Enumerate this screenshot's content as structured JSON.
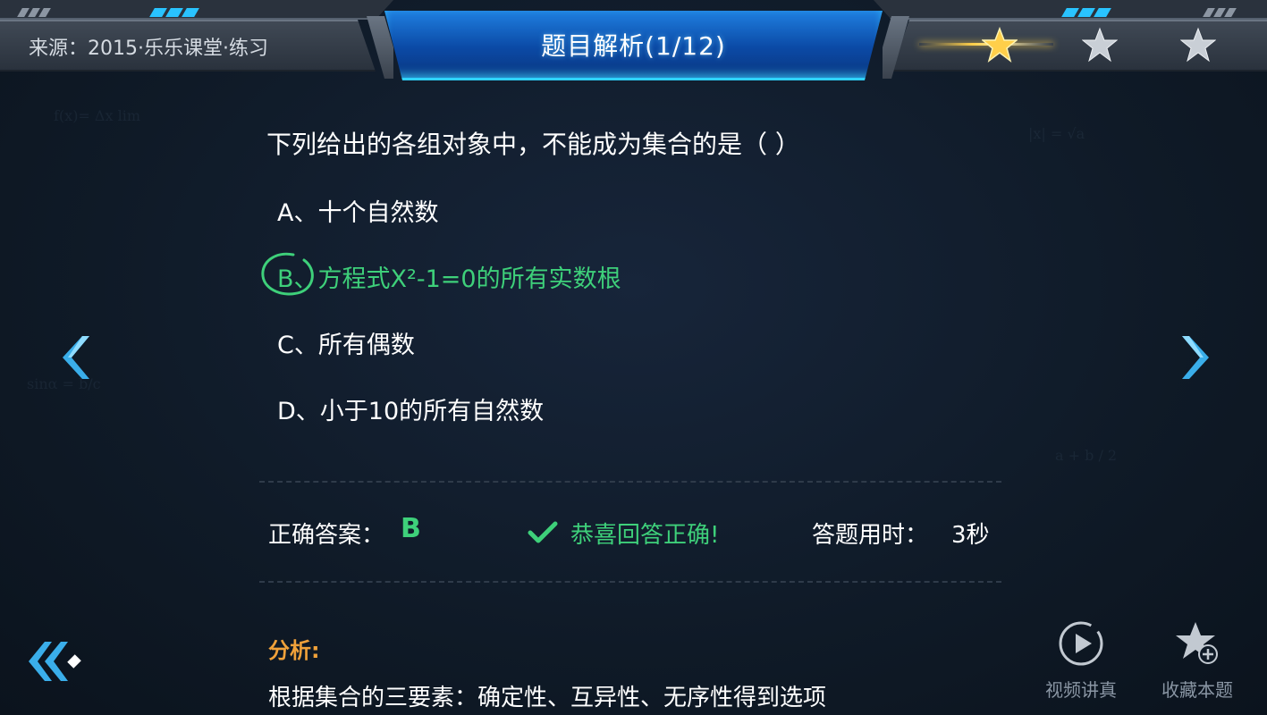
{
  "header": {
    "source": "来源：2015·乐乐课堂·练习",
    "title": "题目解析(1/12)",
    "stars": {
      "filled": 1,
      "total": 3
    }
  },
  "question": {
    "stem": "下列给出的各组对象中，不能成为集合的是（      ）",
    "options": [
      {
        "letter": "A、",
        "text": "十个自然数"
      },
      {
        "letter": "B、",
        "text": "方程式X²-1=0的所有实数根"
      },
      {
        "letter": "C、",
        "text": "所有偶数"
      },
      {
        "letter": "D、",
        "text": "小于10的所有自然数"
      }
    ],
    "selected": "B"
  },
  "result": {
    "answer_label": "正确答案：",
    "answer_value": "B",
    "congrats": "恭喜回答正确!",
    "time_label": "答题用时：",
    "time_value": "3秒"
  },
  "analysis": {
    "title": "分析:",
    "text": "根据集合的三要素：确定性、互异性、无序性得到选项"
  },
  "tools": {
    "video_label": "视频讲真",
    "favorite_label": "收藏本题"
  },
  "colors": {
    "accent_blue": "#29c3ff",
    "correct_green": "#3ed07a",
    "analysis_orange": "#f0a13a",
    "star_gold": "#ffcf4a"
  },
  "icons": {
    "prev": "chevron-left-icon",
    "next": "chevron-right-icon",
    "back": "double-chevron-left-icon",
    "check": "check-icon",
    "video": "play-circle-icon",
    "favorite": "star-plus-icon"
  }
}
